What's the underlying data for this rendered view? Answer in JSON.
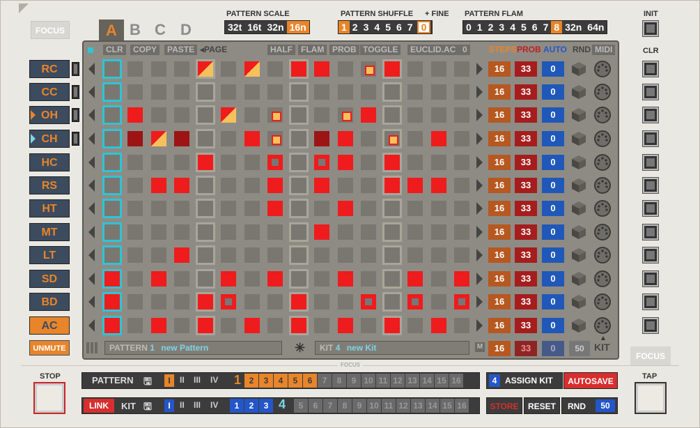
{
  "focus": "FOCUS",
  "focus_small": "FOCUS",
  "focus_right": "FOCUS",
  "pattern_tabs": [
    "A",
    "B",
    "C",
    "D"
  ],
  "pattern_scale": {
    "label": "PATTERN  SCALE",
    "options": [
      "32t",
      "16t",
      "32n",
      "16n"
    ]
  },
  "pattern_shuffle": {
    "label": "PATTERN  SHUFFLE",
    "fine_label": "+ FINE",
    "options": [
      "1",
      "2",
      "3",
      "4",
      "5",
      "6",
      "7"
    ],
    "fine": "0"
  },
  "pattern_flam": {
    "label": "PATTERN  FLAM",
    "options": [
      "0",
      "1",
      "2",
      "3",
      "4",
      "5",
      "6",
      "7",
      "8",
      "32n",
      "64n"
    ]
  },
  "init": "INIT",
  "clr": "CLR",
  "toolbar": {
    "clr": "CLR",
    "copy": "COPY",
    "paste": "PASTE",
    "page": "◂PAGE",
    "half": "HALF",
    "flam": "FLAM",
    "prob": "PROB",
    "toggle": "TOGGLE",
    "euclid": "EUCLID.AC",
    "euclid_val": "0",
    "steps": "STEPS",
    "prob_h": "PROB",
    "auto": "AUTO",
    "rnd": "RND",
    "midi": "MIDI"
  },
  "instruments": [
    "RC",
    "CC",
    "OH",
    "CH",
    "HC",
    "RS",
    "HT",
    "MT",
    "LT",
    "SD",
    "BD",
    "AC"
  ],
  "unmute": "UNMUTE",
  "steps": [
    "16",
    "16",
    "16",
    "16",
    "16",
    "16",
    "16",
    "16",
    "16",
    "16",
    "16",
    "16"
  ],
  "probs": [
    "33",
    "33",
    "33",
    "33",
    "33",
    "33",
    "33",
    "33",
    "33",
    "33",
    "33",
    "33"
  ],
  "autos": [
    "0",
    "0",
    "0",
    "0",
    "0",
    "0",
    "0",
    "0",
    "0",
    "0",
    "0",
    "0"
  ],
  "footer": {
    "pattern_label": "PATTERN",
    "pattern_num": "1",
    "pattern_name": "new Pattern",
    "kit_label": "KIT",
    "kit_num": "4",
    "kit_name": "new Kit",
    "m": "M",
    "steps": "16",
    "prob": "33",
    "auto": "0",
    "rnd": "50",
    "kit": "KIT"
  },
  "stop": "STOP",
  "tap": "TAP",
  "bottom": {
    "pattern": "PATTERN",
    "banks": [
      "I",
      "II",
      "III",
      "IV"
    ],
    "cur": "1",
    "nums": [
      "2",
      "3",
      "4",
      "5",
      "6",
      "7",
      "8",
      "9",
      "10",
      "11",
      "12",
      "13",
      "14",
      "15",
      "16"
    ],
    "kit_assign_num": "4",
    "assign": "ASSIGN KIT",
    "autosave": "AUTOSAVE",
    "link": "LINK",
    "kit": "KIT",
    "kit_nums": [
      "1",
      "2",
      "3"
    ],
    "kit_cur": "4",
    "kit_rest": [
      "5",
      "6",
      "7",
      "8",
      "9",
      "10",
      "11",
      "12",
      "13",
      "14",
      "15",
      "16"
    ],
    "store": "STORE",
    "reset": "RESET",
    "rnd": "RND",
    "rnd_val": "50"
  }
}
